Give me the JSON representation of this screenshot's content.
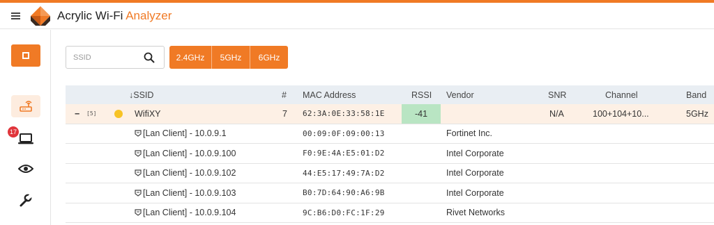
{
  "app": {
    "title_main": "Acrylic Wi-Fi ",
    "title_accent": "Analyzer",
    "accent_color": "#f07a25"
  },
  "sidebar": {
    "items": [
      {
        "name": "stop-capture",
        "icon": "stop-icon"
      },
      {
        "name": "networks",
        "icon": "router-icon",
        "active": true
      },
      {
        "name": "clients",
        "icon": "laptop-icon",
        "badge": "17"
      },
      {
        "name": "monitor",
        "icon": "eye-icon"
      },
      {
        "name": "tools",
        "icon": "wrench-icon"
      }
    ]
  },
  "search": {
    "placeholder": "SSID",
    "value": ""
  },
  "bands": [
    "2.4GHz",
    "5GHz",
    "6GHz"
  ],
  "table": {
    "columns": {
      "ssid": "↓SSID",
      "num": "#",
      "mac": "MAC Address",
      "rssi": "RSSI",
      "vendor": "Vendor",
      "snr": "SNR",
      "channel": "Channel",
      "band": "Band"
    },
    "network": {
      "collapse": "−",
      "count": "[5]",
      "ssid": "WifiXY",
      "num": "7",
      "mac": "62:3A:0E:33:58:1E",
      "rssi": "-41",
      "vendor": "",
      "snr": "N/A",
      "channel": "100+104+10...",
      "band": "5GHz",
      "status_color": "#f7c325",
      "rssi_color": "#b9e5c3"
    },
    "clients": [
      {
        "name": "[Lan Client] - 10.0.9.1",
        "mac": "00:09:0F:09:00:13",
        "vendor": "Fortinet Inc."
      },
      {
        "name": "[Lan Client] - 10.0.9.100",
        "mac": "F0:9E:4A:E5:01:D2",
        "vendor": "Intel Corporate"
      },
      {
        "name": "[Lan Client] - 10.0.9.102",
        "mac": "44:E5:17:49:7A:D2",
        "vendor": "Intel Corporate"
      },
      {
        "name": "[Lan Client] - 10.0.9.103",
        "mac": "B0:7D:64:90:A6:9B",
        "vendor": "Intel Corporate"
      },
      {
        "name": "[Lan Client] - 10.0.9.104",
        "mac": "9C:B6:D0:FC:1F:29",
        "vendor": "Rivet Networks"
      }
    ]
  }
}
